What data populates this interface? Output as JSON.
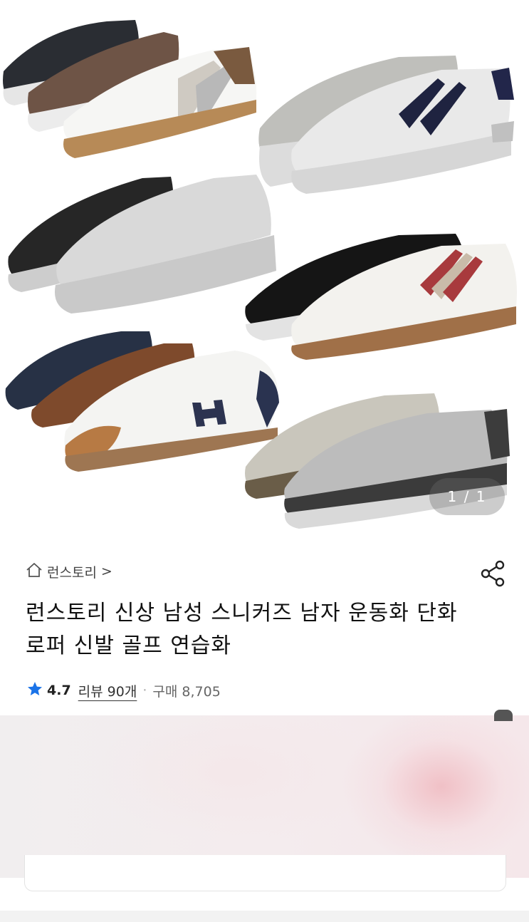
{
  "gallery": {
    "counter": "1 / 1",
    "image_alt": "sneaker-product-image"
  },
  "store": {
    "name": "런스토리",
    "chevron": ">"
  },
  "product": {
    "title": "런스토리 신상 남성 스니커즈 남자 운동화 단화 로퍼 신발 골프 연습화",
    "rating": "4.7",
    "review_label": "리뷰 90개",
    "separator": "·",
    "purchase_label": "구매 8,705"
  },
  "colors": {
    "star": "#1a73e8",
    "text": "#111111",
    "muted": "#666666"
  },
  "icons": [
    "home-icon",
    "share-icon",
    "star-icon"
  ]
}
